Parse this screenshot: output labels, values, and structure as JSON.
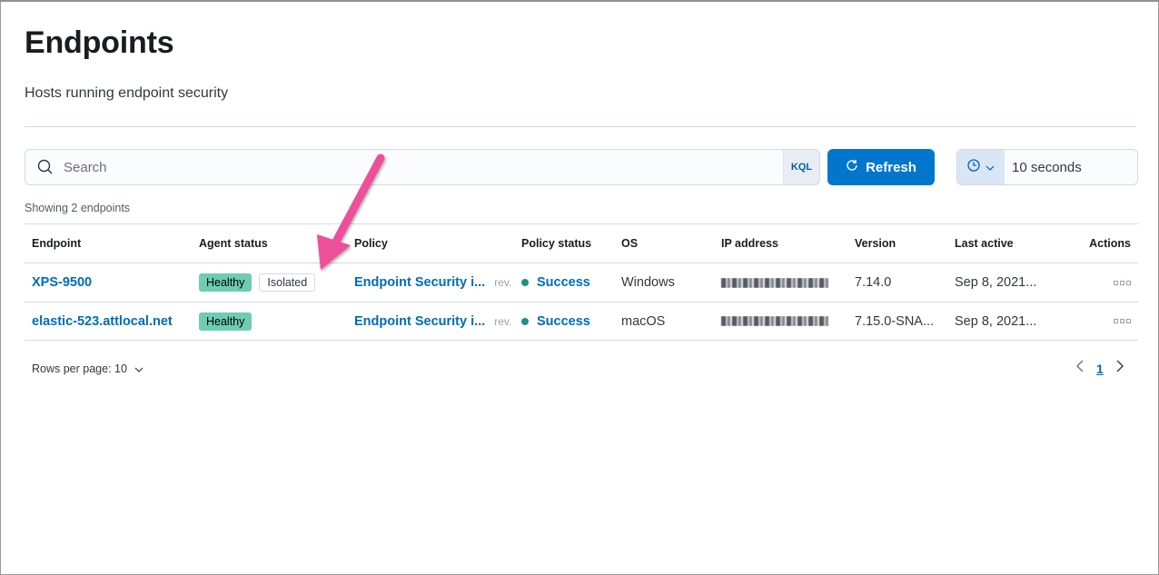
{
  "page": {
    "title": "Endpoints",
    "subtitle": "Hosts running endpoint security"
  },
  "search": {
    "placeholder": "Search",
    "value": "",
    "query_language": "KQL"
  },
  "refresh": {
    "label": "Refresh",
    "interval_value": "10 seconds"
  },
  "summary": "Showing 2 endpoints",
  "table": {
    "columns": [
      "Endpoint",
      "Agent status",
      "Policy",
      "Policy status",
      "OS",
      "IP address",
      "Version",
      "Last active",
      "Actions"
    ],
    "rows": [
      {
        "endpoint": "XPS-9500",
        "agent_status": "Healthy",
        "isolation": "Isolated",
        "policy": "Endpoint Security i...",
        "policy_rev": "rev.",
        "policy_status": "Success",
        "os": "Windows",
        "ip": "[redacted]",
        "version": "7.14.0",
        "last_active": "Sep 8, 2021..."
      },
      {
        "endpoint": "elastic-523.attlocal.net",
        "agent_status": "Healthy",
        "isolation": null,
        "policy": "Endpoint Security i...",
        "policy_rev": "rev.",
        "policy_status": "Success",
        "os": "macOS",
        "ip": "[redacted]",
        "version": "7.15.0-SNA...",
        "last_active": "Sep 8, 2021..."
      }
    ]
  },
  "pagination": {
    "rows_per_page_label": "Rows per page: 10",
    "current_page": "1"
  },
  "colors": {
    "primary": "#0077cc",
    "link": "#006bb8",
    "healthy_badge": "#6dccb1",
    "success_dot": "#209280",
    "annotation_arrow": "#ee4f9b"
  }
}
